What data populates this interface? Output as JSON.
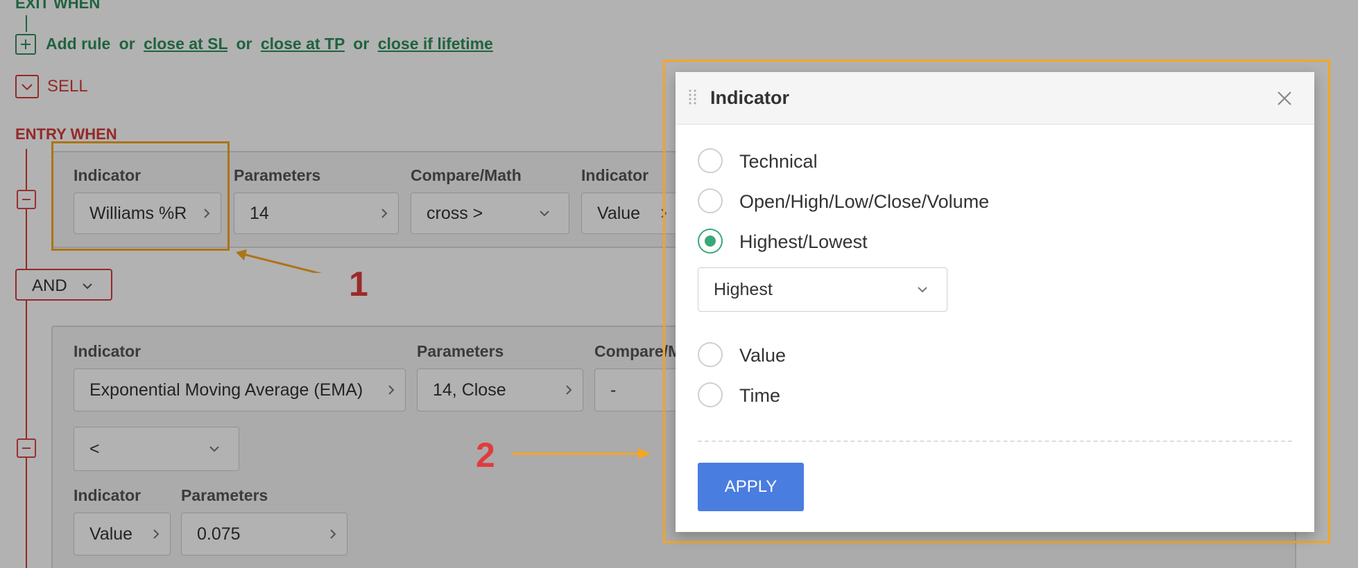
{
  "exit_section": {
    "title": "EXIT WHEN",
    "add_rule": "Add rule",
    "or": "or",
    "close_sl": "close at SL",
    "close_tp": "close at TP",
    "close_lifetime": "close if lifetime"
  },
  "sell": {
    "label": "SELL"
  },
  "entry_section": {
    "title": "ENTRY WHEN",
    "row1": {
      "indicator_label": "Indicator",
      "indicator_value": "Williams %R",
      "parameters_label": "Parameters",
      "parameters_value": "14",
      "compare_label": "Compare/Math",
      "compare_value": "cross >",
      "indicator2_label": "Indicator",
      "indicator2_value": "Value"
    },
    "and_label": "AND",
    "row2": {
      "indicator_label": "Indicator",
      "indicator_value": "Exponential Moving Average (EMA)",
      "parameters_label": "Parameters",
      "parameters_value": "14, Close",
      "compare_label": "Compare/M",
      "compare_value": "-",
      "operator_value": "<",
      "indicator2_label": "Indicator",
      "indicator2_value": "Value",
      "parameters2_label": "Parameters",
      "parameters2_value": "0.075"
    }
  },
  "annotations": {
    "one": "1",
    "two": "2"
  },
  "modal": {
    "title": "Indicator",
    "options": [
      "Technical",
      "Open/High/Low/Close/Volume",
      "Highest/Lowest",
      "Value",
      "Time"
    ],
    "selected_option": "Highest/Lowest",
    "select_value": "Highest",
    "apply_label": "APPLY"
  },
  "colors": {
    "green": "#2f8f5a",
    "red": "#d43b3b",
    "highlight": "#f5a623",
    "apply_blue": "#4a7de0",
    "radio_selected": "#3aa876"
  }
}
